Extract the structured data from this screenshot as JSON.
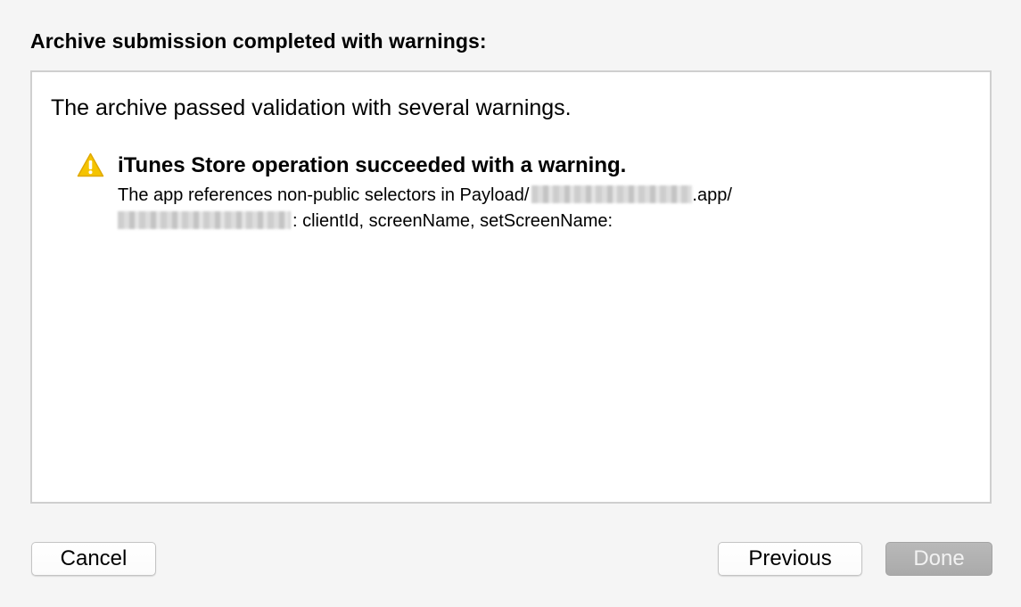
{
  "dialog": {
    "title": "Archive submission completed with warnings:"
  },
  "panel": {
    "summary": "The archive passed validation with several warnings.",
    "warning": {
      "icon": "warning-triangle-icon",
      "heading": "iTunes Store operation succeeded with a warning.",
      "detail_line1_prefix": "The app references non-public selectors in Payload/",
      "detail_line1_suffix": ".app/",
      "detail_line2_suffix": ": clientId, screenName, setScreenName:"
    }
  },
  "buttons": {
    "cancel_label": "Cancel",
    "previous_label": "Previous",
    "done_label": "Done"
  },
  "colors": {
    "background": "#f5f5f5",
    "warning_yellow": "#f5c400",
    "disabled_button": "#b0b0b0"
  }
}
